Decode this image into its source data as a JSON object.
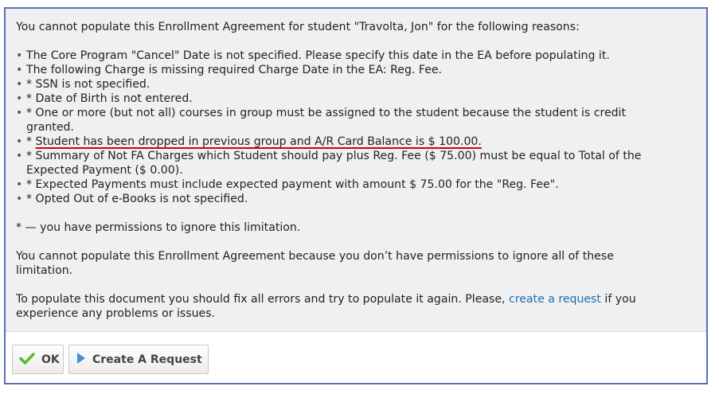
{
  "dialog": {
    "intro": "You cannot populate this Enrollment Agreement for student \"Travolta, Jon\" for the following reasons:",
    "bullet_char": "•",
    "reasons": [
      "The Core Program \"Cancel\" Date is not specified. Please specify this date in the EA before populating it.",
      "The following Charge is missing required Charge Date in the EA: Reg. Fee.",
      "* SSN is not specified.",
      "* Date of Birth is not entered.",
      "* One or more (but not all) courses in group must be assigned to the student because the student is credit\ngranted.",
      "* ",
      "* Summary of Not FA Charges which Student should pay plus Reg. Fee ($ 75.00) must be equal to Total of the\nExpected Payment ($ 0.00).",
      "* Expected Payments must include expected payment with amount $ 75.00 for the \"Reg. Fee\".",
      "* Opted Out of e-Books is not specified."
    ],
    "highlighted_reason": "Student has been dropped in previous group and A/R Card Balance is $ 100.00.",
    "permission_note": "* — you have permissions to ignore this limitation.",
    "no_permission_line1": "You cannot populate this Enrollment Agreement because you don’t have permissions to ignore all of these",
    "no_permission_line2": "limitation.",
    "fix_text_before": "To populate this document you should fix all errors and try to populate it again. Please, ",
    "fix_link": "create a request",
    "fix_text_after": " if you",
    "fix_line2": "experience any problems or issues."
  },
  "buttons": {
    "ok_label": "OK",
    "request_label": "Create A Request"
  },
  "icons": {
    "ok": "checkmark-icon",
    "request": "play-arrow-icon"
  },
  "colors": {
    "border": "#5a6fb8",
    "highlight_underline": "#d40000",
    "link": "#1a6fb5",
    "check_green": "#5cb82e",
    "arrow_blue": "#4a8fd4"
  }
}
